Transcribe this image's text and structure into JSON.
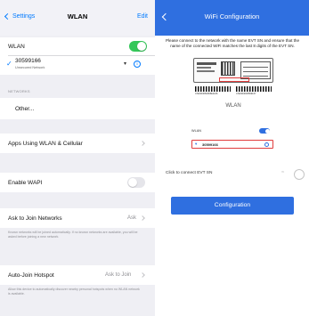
{
  "left_panel": {
    "nav": {
      "back_label": "Settings",
      "title": "WLAN",
      "edit_label": "Edit"
    },
    "wlan_label": "WLAN",
    "wlan_enabled": true,
    "connected_network": {
      "name": "30599166",
      "subtitle": "Unsecured Network"
    },
    "networks_header": "NETWORKS",
    "other_label": "Other...",
    "apps_label": "Apps Using WLAN & Cellular",
    "wapi_label": "Enable WAPI",
    "wapi_enabled": false,
    "ask_join": {
      "label": "Ask to Join Networks",
      "value": "Ask",
      "footer": "Known networks will be joined automatically. If no known networks are available, you will be asked before joining a new network."
    },
    "auto_join": {
      "label": "Auto-Join Hotspot",
      "value": "Ask to Join",
      "footer": "Allow this device to automatically discover nearby personal hotspots when no WLAN network is available."
    }
  },
  "right_panel": {
    "title": "WiFi Configuration",
    "instructions": "Please connect to the network with the name EVT SN and ensure that the name of the connected WiFi matches the last 8 digits of the EVT SN.",
    "illustration": {
      "barcode_left": "CN2303060065E1166",
      "barcode_right": "CN2303030599167",
      "wlan_label": "WLAN",
      "network_name": "30599166"
    },
    "connect_label": "Click to connect EVT SN",
    "configuration_button": "Configuration"
  },
  "colors": {
    "ios_blue": "#007aff",
    "ios_green": "#34c759",
    "brand_blue": "#2f6fe0",
    "highlight_red": "#e03c3c"
  }
}
